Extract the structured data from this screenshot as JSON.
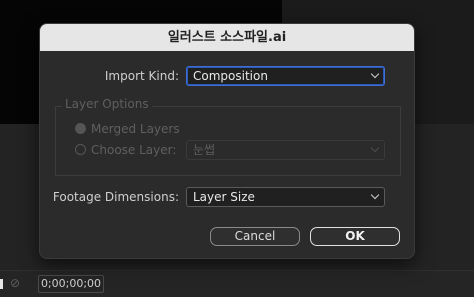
{
  "dialog": {
    "title": "일러스트 소스파일.ai",
    "import_kind": {
      "label": "Import Kind:",
      "value": "Composition"
    },
    "layer_options": {
      "legend": "Layer Options",
      "merged_layers": "Merged Layers",
      "choose_layer": "Choose Layer:",
      "choose_layer_value": "눈썹"
    },
    "footage_dimensions": {
      "label": "Footage Dimensions:",
      "value": "Layer Size"
    },
    "buttons": {
      "cancel": "Cancel",
      "ok": "OK"
    }
  },
  "background": {
    "timecode": "0;00;00;00"
  },
  "colors": {
    "titlebar": "#e6e6e6",
    "dialog_bg": "#2b2b2b",
    "focus_ring": "#3d6fd6"
  }
}
